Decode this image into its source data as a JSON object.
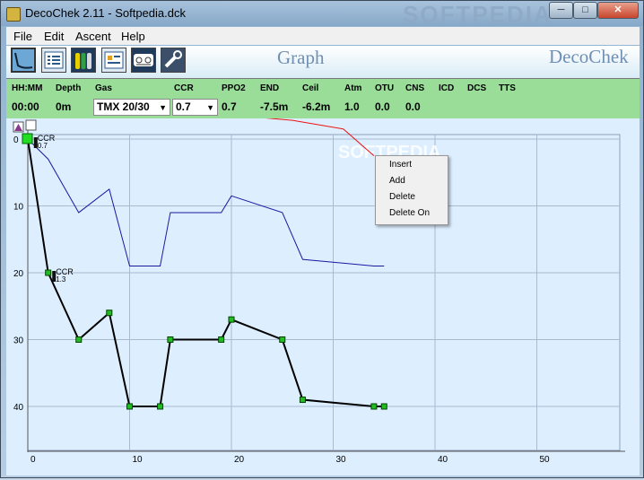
{
  "window": {
    "title": "DecoChek 2.11 - Softpedia.dck",
    "watermark": "SOFTPEDIA"
  },
  "menubar": {
    "file": "File",
    "edit": "Edit",
    "ascent": "Ascent",
    "help": "Help"
  },
  "toolbar": {
    "label_graph": "Graph",
    "label_brand": "DecoChek",
    "tools": [
      "profile-tool-icon",
      "list-tool-icon",
      "tanks-tool-icon",
      "table-tool-icon",
      "dive-sheet-tool-icon",
      "settings-tool-icon"
    ]
  },
  "status": {
    "headers": [
      "HH:MM",
      "Depth",
      "Gas",
      "CCR",
      "PPO2",
      "END",
      "Ceil",
      "Atm",
      "OTU",
      "CNS",
      "ICD",
      "DCS",
      "TTS"
    ],
    "time": "00:00",
    "depth": "0m",
    "gas": "TMX 20/30",
    "ccr": "0.7",
    "ppo2": "0.7",
    "end": "-7.5m",
    "ceil": "-6.2m",
    "atm": "1.0",
    "otu": "0.0",
    "cns": "0.0",
    "bg_color": "#99dd99"
  },
  "context_menu": {
    "items": [
      "Insert",
      "Add",
      "Delete",
      "Delete On"
    ]
  },
  "chart_data": {
    "type": "line",
    "xlim": [
      0,
      55
    ],
    "ylim": [
      0,
      45
    ],
    "y_inverted": true,
    "x_ticks": [
      "0",
      "10",
      "20",
      "30",
      "40",
      "50"
    ],
    "y_ticks": [
      "0",
      "10",
      "20",
      "30",
      "40"
    ],
    "series": [
      {
        "color": "#000000",
        "markers": true,
        "x": [
          0,
          2,
          5,
          8,
          10,
          13,
          14,
          19,
          20,
          25,
          27,
          34,
          35
        ],
        "y": [
          0,
          20,
          30,
          26,
          40,
          40,
          30,
          30,
          27,
          30,
          39,
          40,
          40
        ]
      },
      {
        "color": "#1a1aa0",
        "markers": false,
        "x": [
          0,
          2,
          5,
          8,
          10,
          13,
          14,
          19,
          20,
          25,
          27,
          34,
          35
        ],
        "y": [
          0,
          3,
          11,
          7.5,
          19,
          19,
          11,
          11,
          8.5,
          11,
          18,
          19,
          19
        ]
      },
      {
        "color": "#ee1111",
        "markers": false,
        "x": [
          23,
          26,
          31,
          34
        ],
        "y": [
          -3.2,
          -2.8,
          -1.5,
          2.5
        ]
      }
    ],
    "annotations": [
      {
        "text": "CCR",
        "value": "0.7",
        "x": 0.6,
        "y": 0
      },
      {
        "text": "CCR",
        "value": "1.3",
        "x": 2.4,
        "y": 20
      }
    ],
    "watermark": "SOFTPEDIA",
    "grid": true
  }
}
